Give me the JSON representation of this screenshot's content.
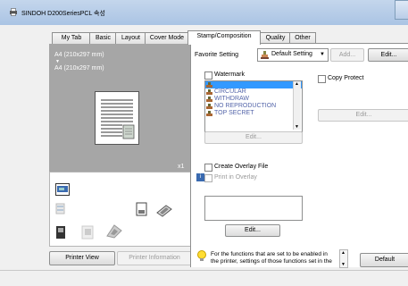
{
  "window": {
    "title": "SINDOH D200SeriesPCL 속성"
  },
  "tabs": [
    {
      "label": "My Tab"
    },
    {
      "label": "Basic"
    },
    {
      "label": "Layout"
    },
    {
      "label": "Cover Mode"
    },
    {
      "label": "Stamp/Composition"
    },
    {
      "label": "Quality"
    },
    {
      "label": "Other"
    }
  ],
  "preview": {
    "paper1": "A4 (210x297 mm)",
    "arrow": "▼",
    "paper2": "A4 (210x297 mm)",
    "copies": "x1"
  },
  "left_buttons": {
    "printer_view": "Printer View",
    "printer_information": "Printer Information"
  },
  "favorite": {
    "label": "Favorite Setting",
    "value": "Default Setting",
    "add": "Add...",
    "edit": "Edit..."
  },
  "watermark": {
    "label": "Watermark",
    "items": [
      "",
      "CIRCULAR",
      "WITHDRAW",
      "NO REPRODUCTION",
      "TOP SECRET"
    ],
    "edit": "Edit..."
  },
  "copy_protect": {
    "label": "Copy Protect",
    "edit": "Edit..."
  },
  "overlay": {
    "create_label": "Create Overlay File",
    "print_label": "Print in Overlay",
    "edit": "Edit..."
  },
  "info": {
    "text_line1": "For the functions that are set to be enabled in",
    "text_line2": "the printer, settings of those functions set in the"
  },
  "default_button": "Default",
  "colors": {
    "accent": "#3399ff",
    "preview_bg": "#a6a6a6"
  }
}
